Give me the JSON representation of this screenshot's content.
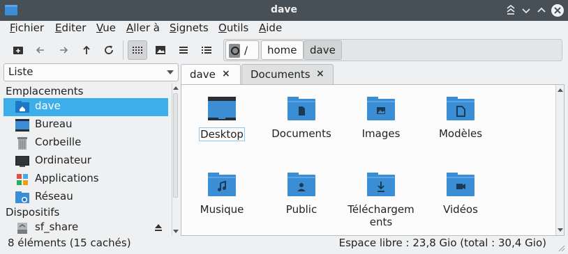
{
  "window": {
    "title": "dave"
  },
  "menu": [
    {
      "u": "F",
      "rest": "ichier"
    },
    {
      "u": "E",
      "rest": "diter"
    },
    {
      "u": "V",
      "rest": "ue"
    },
    {
      "u": "A",
      "rest": "ller à"
    },
    {
      "u": "S",
      "rest": "ignets"
    },
    {
      "u": "O",
      "rest": "utils"
    },
    {
      "u": "A",
      "rest": "ide"
    }
  ],
  "toolbar": {
    "icons": [
      "new-tab-icon",
      "back-icon",
      "forward-icon",
      "up-icon",
      "reload-icon",
      "icon-view-icon",
      "thumbnail-view-icon",
      "compact-view-icon",
      "detailed-list-view-icon"
    ]
  },
  "path": {
    "root": "/",
    "crumbs": [
      "home",
      "dave"
    ]
  },
  "side": {
    "mode": "Liste",
    "places_header": "Emplacements",
    "places": [
      {
        "label": "dave",
        "icon": "home-folder-icon",
        "selected": true
      },
      {
        "label": "Bureau",
        "icon": "desktop-icon"
      },
      {
        "label": "Corbeille",
        "icon": "trash-icon"
      },
      {
        "label": "Ordinateur",
        "icon": "computer-icon"
      },
      {
        "label": "Applications",
        "icon": "applications-icon"
      },
      {
        "label": "Réseau",
        "icon": "network-icon"
      }
    ],
    "devices_header": "Dispositifs",
    "devices": [
      {
        "label": "sf_share",
        "icon": "drive-icon"
      }
    ]
  },
  "tabs": [
    {
      "label": "dave",
      "active": true
    },
    {
      "label": "Documents",
      "active": false
    }
  ],
  "close_glyph": "×",
  "files": [
    {
      "name": "Desktop",
      "icon": "desktop-folder-icon",
      "selected": true
    },
    {
      "name": "Documents",
      "icon": "documents-folder-icon"
    },
    {
      "name": "Images",
      "icon": "pictures-folder-icon"
    },
    {
      "name": "Modèles",
      "icon": "templates-folder-icon"
    },
    {
      "name": "Musique",
      "icon": "music-folder-icon"
    },
    {
      "name": "Public",
      "icon": "public-folder-icon"
    },
    {
      "name": "Téléchargements",
      "icon": "downloads-folder-icon"
    },
    {
      "name": "Vidéos",
      "icon": "videos-folder-icon"
    }
  ],
  "status": {
    "left": "8 éléments (15 cachés)",
    "right": "Espace libre : 23,8 Gio (total : 30,4 Gio)"
  },
  "colors": {
    "titlebar": "#475057",
    "folder": "#3b8ed3",
    "folder_tab": "#5aa5e8",
    "selection": "#3daee9"
  }
}
